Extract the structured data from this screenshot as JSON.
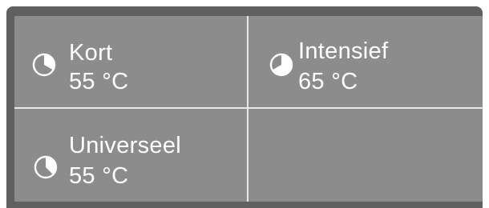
{
  "programs": [
    {
      "name": "Kort",
      "temperature": "55 °C",
      "icon": "pie-clock-icon"
    },
    {
      "name": "Intensief",
      "temperature": "65 °C",
      "icon": "pie-clock-icon"
    },
    {
      "name": "Universeel",
      "temperature": "55 °C",
      "icon": "pie-clock-icon"
    }
  ],
  "colors": {
    "bezel": "#606060",
    "screen": "#8c8c8c",
    "text": "#ffffff",
    "divider": "#e8e8e8"
  }
}
